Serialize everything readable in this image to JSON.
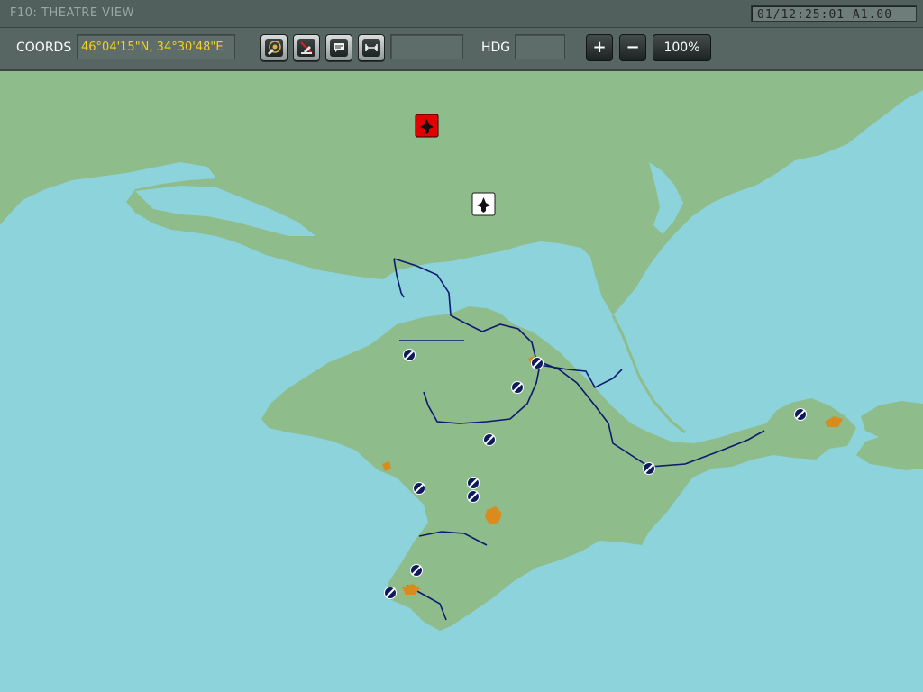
{
  "window": {
    "title": "F10: THEATRE VIEW",
    "clock": "01/12:25:01 A1.00"
  },
  "toolbar": {
    "coords_label": "COORDS",
    "coords_value": "46°04'15\"N, 34°30'48\"E",
    "hdg_label": "HDG",
    "hdg_value": "",
    "range_value": "",
    "zoom_in": "+",
    "zoom_out": "−",
    "zoom_level": "100%",
    "tool_icons": [
      "airfield-filter-icon",
      "sam-filter-icon",
      "message-icon",
      "ruler-icon"
    ]
  },
  "colors": {
    "sea": "#8dd3dc",
    "land": "#8ebc8b",
    "road": "#0d1a6e",
    "town": "#d98b1e",
    "hostile": "#e20000"
  },
  "map": {
    "units": [
      {
        "side": "hostile",
        "type": "aircraft"
      },
      {
        "side": "neutral",
        "type": "aircraft"
      }
    ],
    "airfields_count": 13,
    "towns_count": 6
  }
}
